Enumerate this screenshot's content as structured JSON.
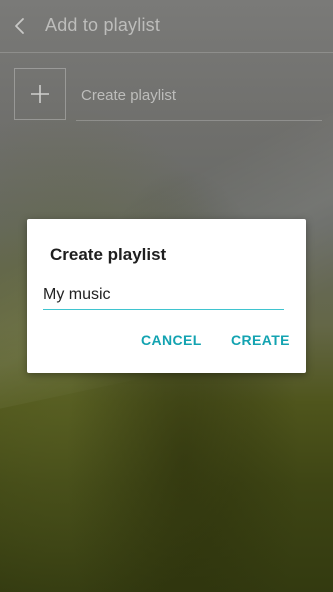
{
  "header": {
    "title": "Add to playlist",
    "back_icon": "chevron-left-icon"
  },
  "create_row": {
    "icon": "plus-icon",
    "label": "Create playlist"
  },
  "dialog": {
    "title": "Create playlist",
    "input_value": "My music",
    "cancel_label": "CANCEL",
    "create_label": "CREATE",
    "accent_color": "#13a3b1",
    "input_underline_color": "#3fc4cf"
  }
}
